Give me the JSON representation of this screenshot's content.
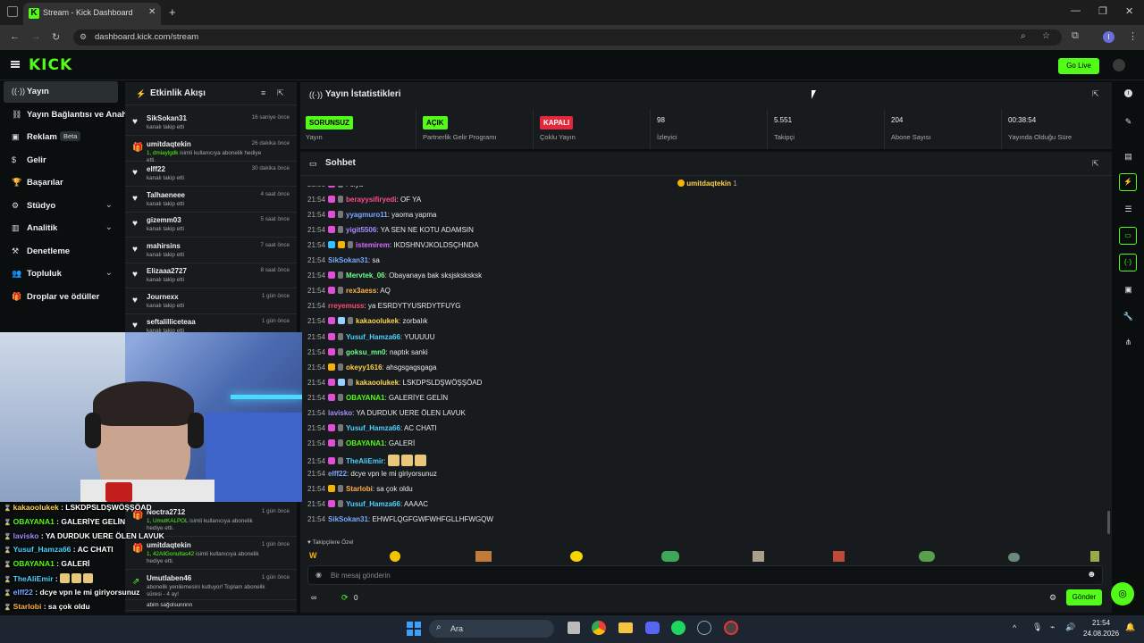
{
  "browser": {
    "tab_title": "Stream - Kick Dashboard",
    "url": "dashboard.kick.com/stream",
    "new_tab": "+",
    "profile_initial": "I"
  },
  "header": {
    "logo": "KICK",
    "go_live": "Go Live"
  },
  "sidebar": {
    "items": [
      {
        "label": "Yayın",
        "icon": "broadcast-icon",
        "active": true
      },
      {
        "label": "Yayın Bağlantısı ve Anahtarı",
        "icon": "link-icon"
      },
      {
        "label": "Reklam",
        "icon": "ad-icon",
        "badge": "Beta"
      },
      {
        "label": "Gelir",
        "icon": "dollar-icon"
      },
      {
        "label": "Başarılar",
        "icon": "trophy-icon"
      },
      {
        "label": "Stüdyo",
        "icon": "studio-icon",
        "expandable": true
      },
      {
        "label": "Analitik",
        "icon": "chart-icon",
        "expandable": true
      },
      {
        "label": "Denetleme",
        "icon": "hammer-icon"
      },
      {
        "label": "Topluluk",
        "icon": "community-icon",
        "expandable": true
      },
      {
        "label": "Droplar ve ödüller",
        "icon": "gift-icon"
      }
    ]
  },
  "activity": {
    "title": "Etkinlik Akışı",
    "items": [
      {
        "name": "SikSokan31",
        "desc": "kanalı takip etti",
        "time": "16 saniye önce",
        "icon": "heart"
      },
      {
        "name": "umitdaqtekin",
        "desc_prefix": "1, dmiaylgdk",
        "desc": " isimli kullanıcıya abonelik hediye etti.",
        "time": "26 dakika önce",
        "icon": "gift"
      },
      {
        "name": "elff22",
        "desc": "kanalı takip etti",
        "time": "30 dakika önce",
        "icon": "heart"
      },
      {
        "name": "Talhaeneee",
        "desc": "kanalı takip etti",
        "time": "4 saat önce",
        "icon": "heart"
      },
      {
        "name": "gizemm03",
        "desc": "kanalı takip etti",
        "time": "5 saat önce",
        "icon": "heart"
      },
      {
        "name": "mahirsins",
        "desc": "kanalı takip etti",
        "time": "7 saat önce",
        "icon": "heart"
      },
      {
        "name": "Elizaaa2727",
        "desc": "kanalı takip etti",
        "time": "8 saat önce",
        "icon": "heart"
      },
      {
        "name": "Journexx",
        "desc": "kanalı takip etti",
        "time": "1 gün önce",
        "icon": "heart"
      },
      {
        "name": "seftalilliceteaa",
        "desc": "kanalı takip etti",
        "time": "1 gün önce",
        "icon": "heart"
      }
    ],
    "lower_items": [
      {
        "name": "Noctra2712",
        "desc_prefix": "1, UmutKALPOL",
        "desc": " isimli kullanıcıya abonelik hediye etti.",
        "time": "1 gün önce",
        "icon": "gift"
      },
      {
        "name": "umitdaqtekin",
        "desc_prefix": "1, 42AllGonultas42",
        "desc": " isimli kullanıcıya abonelik hediye etti.",
        "time": "1 gün önce",
        "icon": "gift"
      },
      {
        "name": "Umutlaben46",
        "desc": "abonelik yenilemesini kutluyor! Toplam abonelik süresi - 4 ay!",
        "time": "1 gün önce",
        "icon": "renew"
      },
      {
        "name": "",
        "desc": "abim sağolsunnnn",
        "time": "",
        "icon": ""
      }
    ]
  },
  "stats": {
    "title": "Yayın İstatistikleri",
    "items": [
      {
        "value": "SORUNSUZ",
        "label": "Yayın",
        "badge": true,
        "color": "#53fc18"
      },
      {
        "value": "AÇIK",
        "label": "Partnerlik Gelir Programı",
        "badge": true,
        "color": "#53fc18"
      },
      {
        "value": "KAPALI",
        "label": "Çoklu Yayın",
        "badge": true,
        "color": "#e3283c"
      },
      {
        "value": "98",
        "label": "İzleyici"
      },
      {
        "value": "5.551",
        "label": "Takipçi"
      },
      {
        "value": "204",
        "label": "Abone Sayısı"
      },
      {
        "value": "00:38:54",
        "label": "Yayında Olduğu Süre"
      }
    ]
  },
  "chat": {
    "title": "Sohbet",
    "pinned_user": "umitdaqtekin",
    "pinned_count": "1",
    "messages": [
      {
        "time": "21:53",
        "user": "",
        "color": "#ff4d6d",
        "text": ": oiya",
        "badges": [
          "#e24fd7"
        ]
      },
      {
        "time": "21:54",
        "user": "berayysifiryedi",
        "color": "#ff4d8a",
        "text": ": OF YA",
        "badges": [
          "#e24fd7"
        ]
      },
      {
        "time": "21:54",
        "user": "yyagmuro11",
        "color": "#7aa9ff",
        "text": ": yaoma yapma",
        "badges": [
          "#e24fd7"
        ]
      },
      {
        "time": "21:54",
        "user": "yigit5506",
        "color": "#a58cff",
        "text": ": YA SEN NE KOTU ADAMSIN",
        "badges": [
          "#e24fd7"
        ]
      },
      {
        "time": "21:54",
        "user": "istemirem",
        "color": "#d86bff",
        "text": ": IKDSHNVJKOLDSÇHNDA",
        "badges": [
          "#2ec4ff",
          "#f5b400"
        ]
      },
      {
        "time": "21:54",
        "user": "SikSokan31",
        "color": "#7aa9ff",
        "text": ": sa",
        "badges": []
      },
      {
        "time": "21:54",
        "user": "Mervtek_06",
        "color": "#6bff8a",
        "text": ": Obayanaya bak sksjsksksksk",
        "badges": [
          "#e24fd7"
        ]
      },
      {
        "time": "21:54",
        "user": "rex3aess",
        "color": "#ffb14d",
        "text": ": AQ",
        "badges": [
          "#e24fd7"
        ]
      },
      {
        "time": "21:54",
        "user": "rreyemuss",
        "color": "#ff4d6d",
        "text": ": ya ESRDYTYUSRDYTFUYG",
        "badges": []
      },
      {
        "time": "21:54",
        "user": "kakaoolukek",
        "color": "#ffd24d",
        "text": ": zorbalık",
        "badges": [
          "#e24fd7",
          "#9ad0ff"
        ]
      },
      {
        "time": "21:54",
        "user": "Yusuf_Hamza66",
        "color": "#4dd2ff",
        "text": ": YUUUUU",
        "badges": [
          "#e24fd7"
        ]
      },
      {
        "time": "21:54",
        "user": "goksu_mn0",
        "color": "#6bff8a",
        "text": ": naptık sanki",
        "badges": [
          "#e24fd7"
        ]
      },
      {
        "time": "21:54",
        "user": "okeyy1616",
        "color": "#ffd24d",
        "text": ": ahsgsgagsgaga",
        "badges": [
          "#f5b400"
        ]
      },
      {
        "time": "21:54",
        "user": "kakaoolukek",
        "color": "#ffd24d",
        "text": ": LSKDPSLDŞWÖŞŞÖAD",
        "badges": [
          "#e24fd7",
          "#9ad0ff"
        ]
      },
      {
        "time": "21:54",
        "user": "OBAYANA1",
        "color": "#53fc18",
        "text": ": GALERİYE GELİN",
        "badges": [
          "#e24fd7"
        ]
      },
      {
        "time": "21:54",
        "user": "lavisko",
        "color": "#a58cff",
        "text": ": YA DURDUK UERE ÖLEN LAVUK",
        "badges": []
      },
      {
        "time": "21:54",
        "user": "Yusuf_Hamza66",
        "color": "#4dd2ff",
        "text": ": AC CHATI",
        "badges": [
          "#e24fd7"
        ]
      },
      {
        "time": "21:54",
        "user": "OBAYANA1",
        "color": "#53fc18",
        "text": ": GALERİ",
        "badges": [
          "#e24fd7"
        ]
      },
      {
        "time": "21:54",
        "user": "TheAliEmir",
        "color": "#4dd2ff",
        "text": ": ",
        "badges": [
          "#e24fd7"
        ],
        "emotes": 3
      },
      {
        "time": "21:54",
        "user": "elff22",
        "color": "#7aa9ff",
        "text": ": dcye vpn le mi giriyorsunuz",
        "badges": []
      },
      {
        "time": "21:54",
        "user": "Starlobi",
        "color": "#ffb14d",
        "text": ": sa çok oldu",
        "badges": [
          "#f5b400"
        ]
      },
      {
        "time": "21:54",
        "user": "Yusuf_Hamza66",
        "color": "#4dd2ff",
        "text": ": AAAAC",
        "badges": [
          "#e24fd7"
        ]
      },
      {
        "time": "21:54",
        "user": "SikSokan31",
        "color": "#7aa9ff",
        "text": ": EHWFLQGFGWFWHFGLLHFWGQW",
        "badges": []
      }
    ],
    "emote_section": "Takipçilere Özel",
    "input_placeholder": "Bir mesaj gönderin",
    "points": "0",
    "send": "Gönder"
  },
  "overlay_chat": [
    {
      "user": "kakaoolukek",
      "color": "#ffd24d",
      "text": " : LSKDPSLDŞWÖŞŞÖAD"
    },
    {
      "user": "OBAYANA1",
      "color": "#53fc18",
      "text": " : GALERİYE GELİN"
    },
    {
      "user": "lavisko",
      "color": "#a58cff",
      "text": " : YA DURDUK UERE ÖLEN LAVUK"
    },
    {
      "user": "Yusuf_Hamza66",
      "color": "#4dd2ff",
      "text": " : AC CHATI"
    },
    {
      "user": "OBAYANA1",
      "color": "#53fc18",
      "text": " : GALERİ"
    },
    {
      "user": "TheAliEmir",
      "color": "#4dd2ff",
      "text": " : "
    },
    {
      "user": "elff22",
      "color": "#7aa9ff",
      "text": " : dcye vpn le mi giriyorsunuz"
    },
    {
      "user": "Starlobi",
      "color": "#ffb14d",
      "text": " : sa çok oldu"
    },
    {
      "user": "Yusuf_Hamza66",
      "color": "#4dd2ff",
      "text": " : AAAAC"
    },
    {
      "user": "SikSokan31",
      "color": "#7aa9ff",
      "text": " : EHWFLQGFGWFWHFGLLHFWGQW"
    }
  ],
  "taskbar": {
    "search": "Ara",
    "time": "21:54",
    "date": "24.08.2026"
  }
}
